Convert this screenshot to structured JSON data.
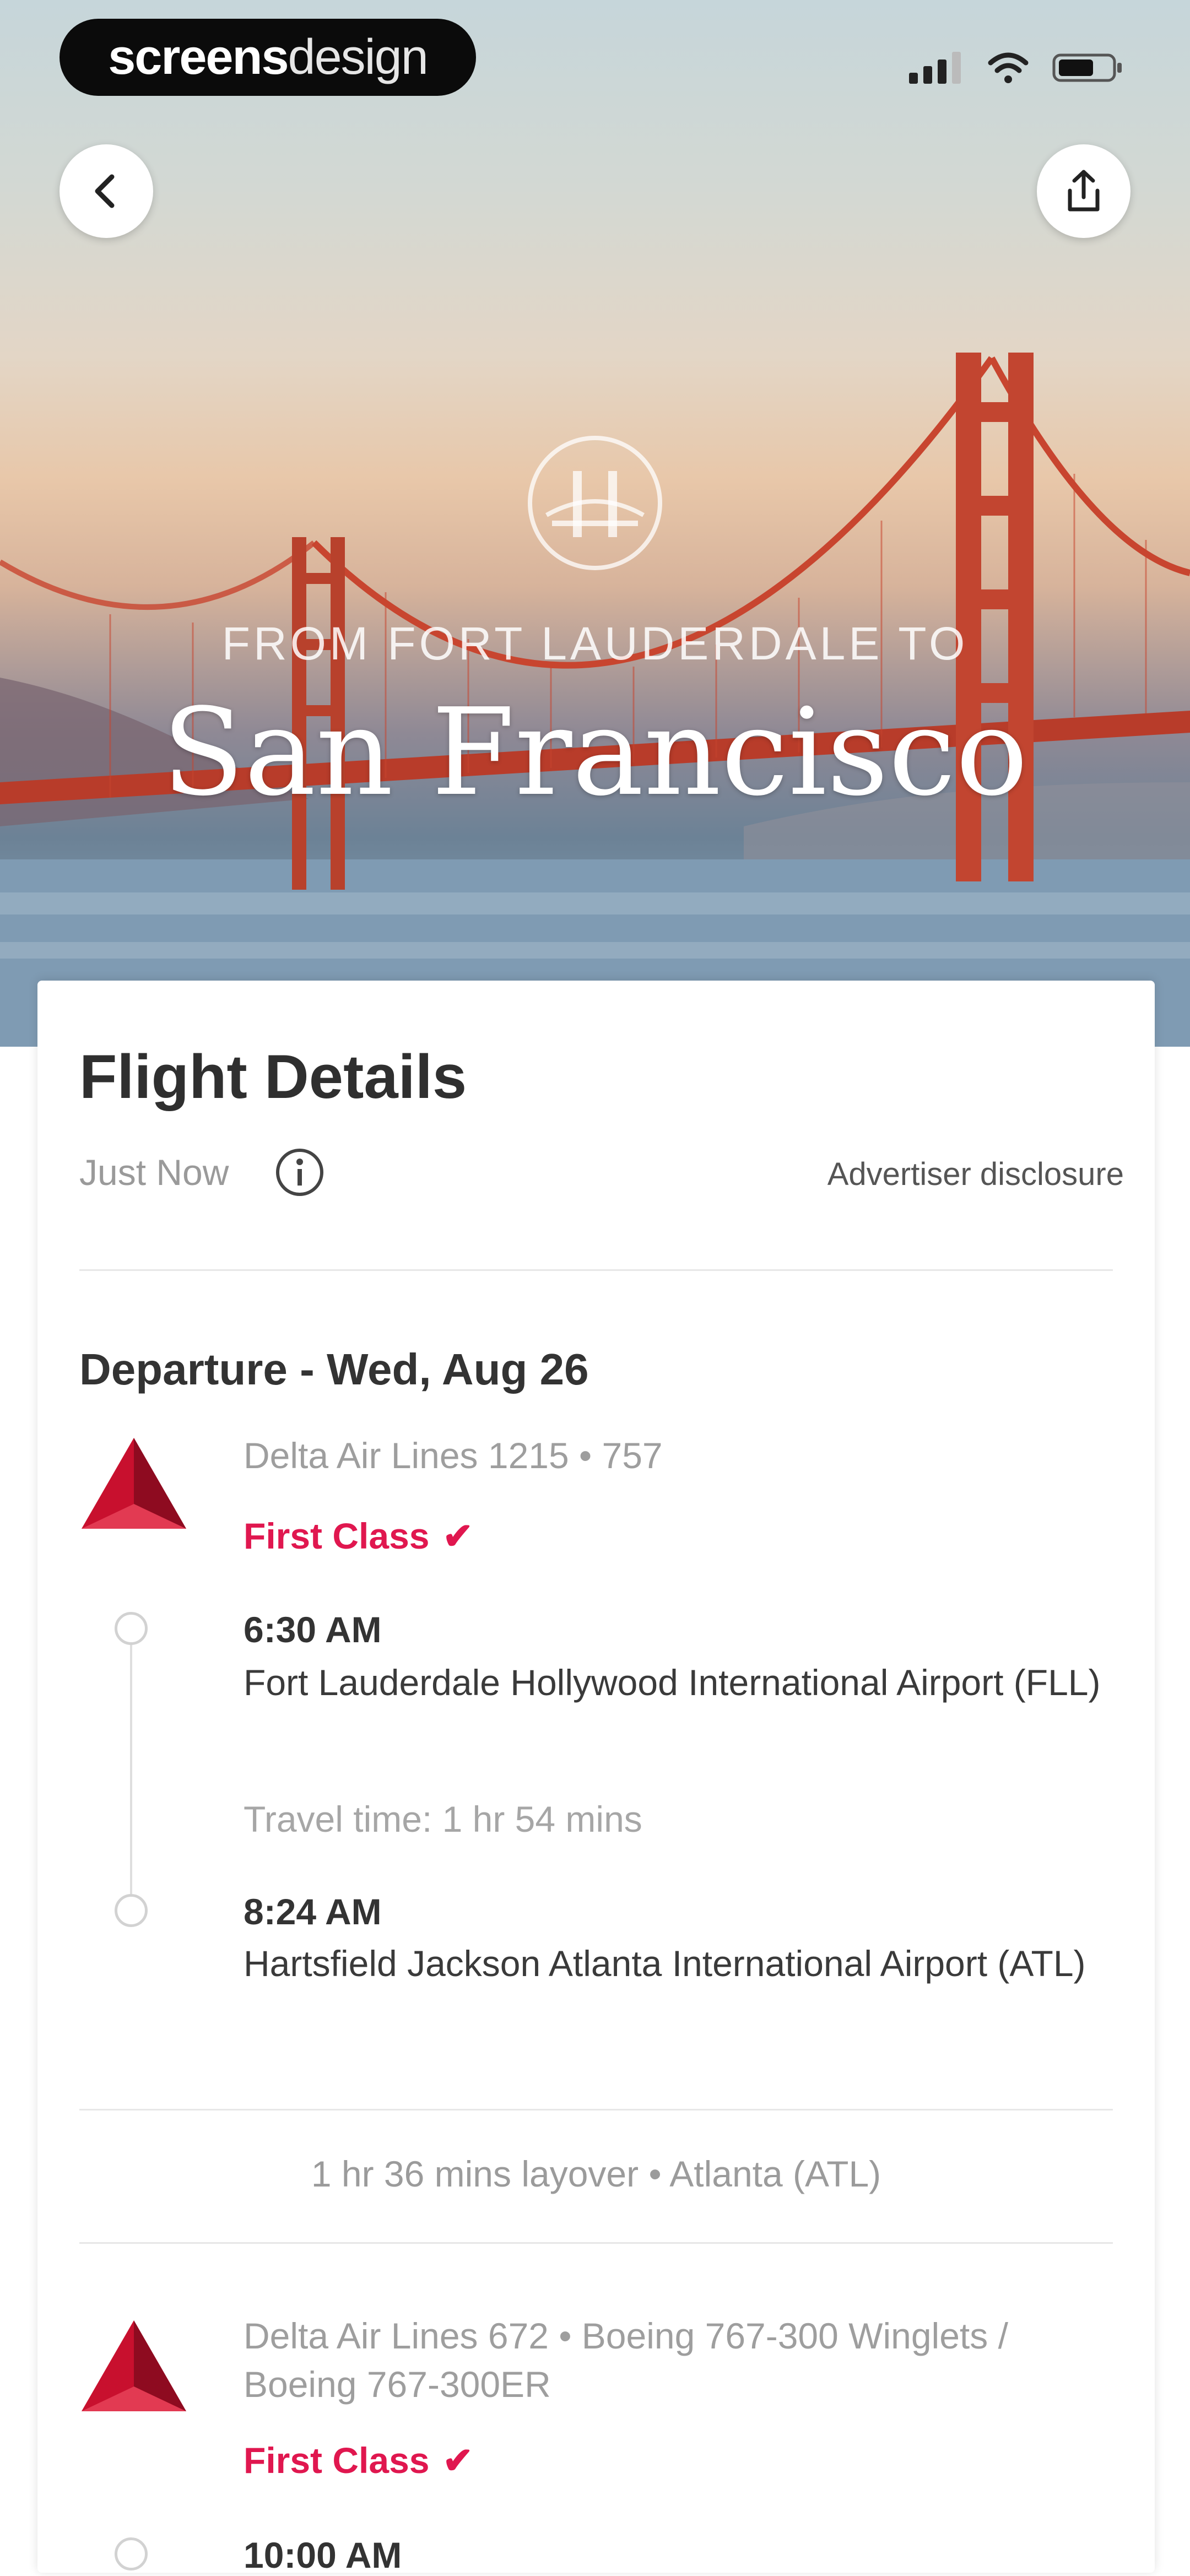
{
  "colors": {
    "accent": "#e0174f",
    "bridge": "#c8452f",
    "delta_red": "#c8102e",
    "card_bg": "#ffffff"
  },
  "brand": {
    "bold": "screens",
    "light": "design"
  },
  "status_icons": [
    "signal-icon",
    "wifi-icon",
    "battery-icon"
  ],
  "header": {
    "back_icon": "chevron-left-icon",
    "share_icon": "share-icon",
    "from_line": "FROM FORT LAUDERDALE TO",
    "city": "San Francisco"
  },
  "flight_details": {
    "title": "Flight Details",
    "updated": "Just Now",
    "disclosure": "Advertiser disclosure",
    "departure_heading": "Departure - Wed, Aug 26",
    "segments": [
      {
        "flight": "Delta Air Lines 1215 • 757",
        "cabin": "First Class",
        "depart_time": "6:30 AM",
        "depart_airport": "Fort Lauderdale Hollywood International Airport (FLL)",
        "travel_time": "Travel time: 1 hr 54 mins",
        "arrive_time": "8:24 AM",
        "arrive_airport": "Hartsfield Jackson Atlanta International Airport (ATL)"
      },
      {
        "flight": "Delta Air Lines 672 • Boeing 767-300 Winglets / Boeing 767-300ER",
        "cabin": "First Class",
        "depart_time": "10:00 AM"
      }
    ],
    "layover": "1 hr 36 mins layover • Atlanta (ATL)"
  }
}
